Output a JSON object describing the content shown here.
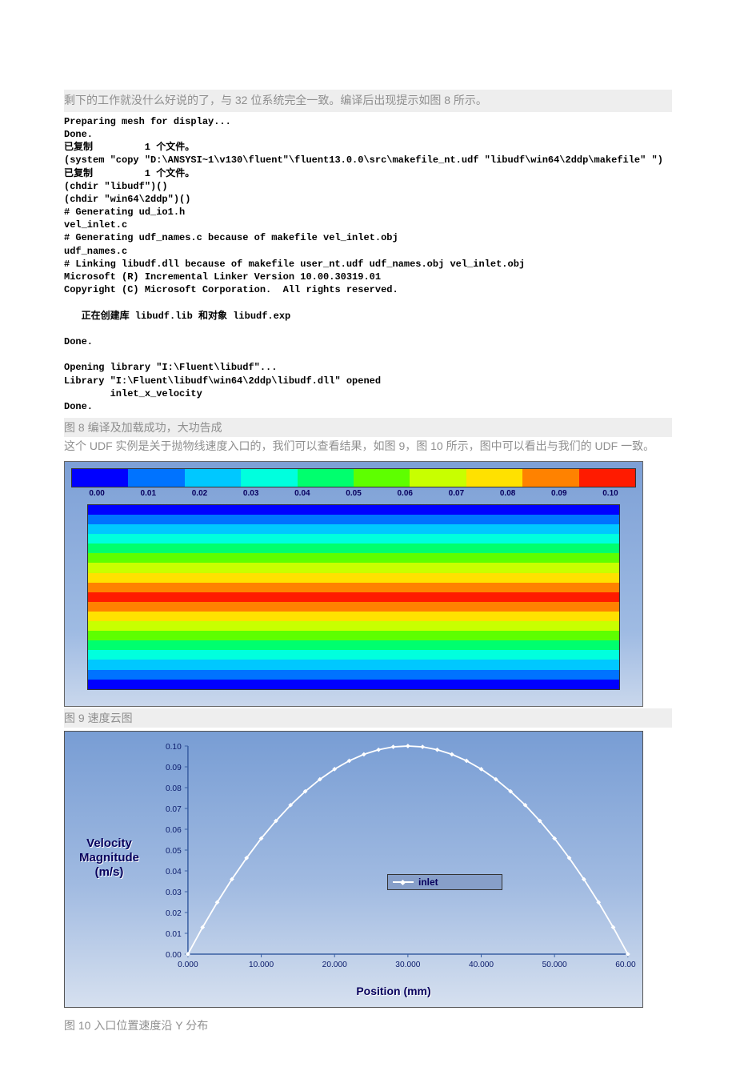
{
  "intro_text": "剩下的工作就没什么好说的了，与 32 位系统完全一致。编译后出现提示如图 8 所示。",
  "console_text": "Preparing mesh for display...\nDone.\n已复制         1 个文件。\n(system \"copy \"D:\\ANSYSI~1\\v130\\fluent\"\\fluent13.0.0\\src\\makefile_nt.udf \"libudf\\win64\\2ddp\\makefile\" \")\n已复制         1 个文件。\n(chdir \"libudf\")()\n(chdir \"win64\\2ddp\")()\n# Generating ud_io1.h\nvel_inlet.c\n# Generating udf_names.c because of makefile vel_inlet.obj\nudf_names.c\n# Linking libudf.dll because of makefile user_nt.udf udf_names.obj vel_inlet.obj\nMicrosoft (R) Incremental Linker Version 10.00.30319.01\nCopyright (C) Microsoft Corporation.  All rights reserved.\n\n   正在创建库 libudf.lib 和对象 libudf.exp\n\nDone.\n\nOpening library \"I:\\Fluent\\libudf\"...\nLibrary \"I:\\Fluent\\libudf\\win64\\2ddp\\libudf.dll\" opened\n        inlet_x_velocity\nDone.",
  "caption_8": "图 8 编译及加载成功，大功告成",
  "para_9_10": "这个 UDF 实例是关于抛物线速度入口的，我们可以查看结果，如图 9，图 10 所示，图中可以看出与我们的 UDF 一致。",
  "contour": {
    "scale_colors": [
      "#0000ff",
      "#0073ff",
      "#00c8ff",
      "#00ffde",
      "#00ff6e",
      "#5eff00",
      "#c8ff00",
      "#ffe100",
      "#ff8200",
      "#ff1b00"
    ],
    "scale_labels": [
      "0.00",
      "0.01",
      "0.02",
      "0.03",
      "0.04",
      "0.05",
      "0.06",
      "0.07",
      "0.08",
      "0.09",
      "0.10"
    ]
  },
  "caption_9": "图 9 速度云图",
  "xyplot": {
    "yaxis_title": "Velocity Magnitude (m/s)",
    "xaxis_title": "Position (mm)",
    "legend": "inlet",
    "y_ticks": [
      "0.00",
      "0.01",
      "0.02",
      "0.03",
      "0.04",
      "0.05",
      "0.06",
      "0.07",
      "0.08",
      "0.09",
      "0.10"
    ],
    "x_ticks": [
      "0.000",
      "10.000",
      "20.000",
      "30.000",
      "40.000",
      "50.000",
      "60.000"
    ]
  },
  "caption_10": "图 10 入口位置速度沿 Y 分布",
  "chart_data": [
    {
      "type": "contour-legend",
      "colors": [
        "#0000ff",
        "#0073ff",
        "#00c8ff",
        "#00ffde",
        "#00ff6e",
        "#5eff00",
        "#c8ff00",
        "#ffe100",
        "#ff8200",
        "#ff1b00"
      ],
      "ticks": [
        0.0,
        0.01,
        0.02,
        0.03,
        0.04,
        0.05,
        0.06,
        0.07,
        0.08,
        0.09,
        0.1
      ],
      "title": "速度云图",
      "note": "Velocity magnitude contour of channel; symmetric horizontal bands, red center (max), blue edges (min)."
    },
    {
      "type": "line",
      "title": "入口位置速度沿 Y 分布",
      "xlabel": "Position (mm)",
      "ylabel": "Velocity Magnitude (m/s)",
      "xlim": [
        0,
        60
      ],
      "ylim": [
        0,
        0.1
      ],
      "series": [
        {
          "name": "inlet",
          "x": [
            0,
            2,
            4,
            6,
            8,
            10,
            12,
            14,
            16,
            18,
            20,
            22,
            24,
            26,
            28,
            30,
            32,
            34,
            36,
            38,
            40,
            42,
            44,
            46,
            48,
            50,
            52,
            54,
            56,
            58,
            60
          ],
          "values": [
            0.0,
            0.0129,
            0.0249,
            0.036,
            0.0462,
            0.0556,
            0.064,
            0.0716,
            0.0782,
            0.084,
            0.0889,
            0.0929,
            0.096,
            0.0982,
            0.0996,
            0.1,
            0.0996,
            0.0982,
            0.096,
            0.0929,
            0.0889,
            0.084,
            0.0782,
            0.0716,
            0.064,
            0.0556,
            0.0462,
            0.036,
            0.0249,
            0.0129,
            0.0
          ]
        }
      ]
    }
  ]
}
